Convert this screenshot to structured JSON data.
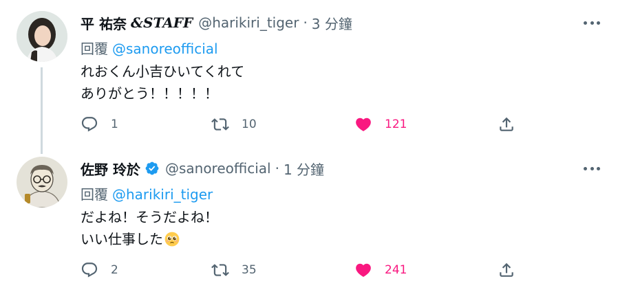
{
  "thread": [
    {
      "author": {
        "name": "平 祐奈",
        "name_suffix": "&STAFF",
        "handle": "@harikiri_tiger",
        "time": "3 分鐘",
        "verified": false
      },
      "reply_prefix": "回覆",
      "reply_to": "@sanoreofficial",
      "text_lines": [
        "れおくん小吉ひいてくれて",
        "ありがとう！！！！！"
      ],
      "stats": {
        "replies": "1",
        "retweets": "10",
        "likes": "121"
      },
      "liked": true
    },
    {
      "author": {
        "name": "佐野 玲於",
        "name_suffix": "",
        "handle": "@sanoreofficial",
        "time": "1 分鐘",
        "verified": true
      },
      "reply_prefix": "回覆",
      "reply_to": "@harikiri_tiger",
      "text_lines": [
        "だよね！そうだよね！",
        "いい仕事した"
      ],
      "emoji": "pleading-face",
      "stats": {
        "replies": "2",
        "retweets": "35",
        "likes": "241"
      },
      "liked": true
    }
  ],
  "separator": "·",
  "colors": {
    "accent": "#1d9bf0",
    "like": "#f91880",
    "secondary": "#536471",
    "line": "#cfd9de"
  }
}
